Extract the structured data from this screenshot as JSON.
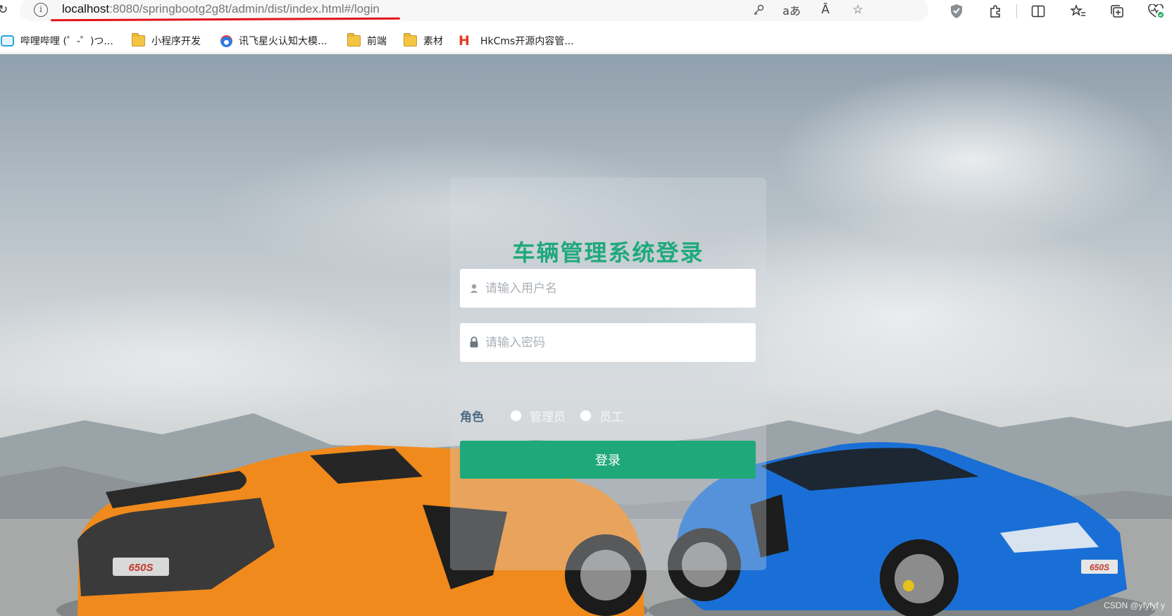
{
  "browser": {
    "url_host": "localhost",
    "url_path": ":8080/springbootg2g8t/admin/dist/index.html#/login",
    "omnibox_icons": [
      "key-icon",
      "translate-icon",
      "read-aloud-icon",
      "favorite-star-icon"
    ],
    "toolbar_icons": [
      "shield-icon",
      "extensions-icon",
      "split-screen-icon",
      "favorites-icon",
      "collections-icon",
      "browser-essentials-icon"
    ],
    "translate_glyph": "aあ",
    "read_aloud_glyph": "Ȃ",
    "bookmarks": [
      {
        "label": "哔哩哔哩 (゜-゜)つ...",
        "icon": "bilibili-tv-icon"
      },
      {
        "label": "小程序开发",
        "icon": "folder-icon"
      },
      {
        "label": "讯飞星火认知大模...",
        "icon": "spark-logo-icon"
      },
      {
        "label": "前端",
        "icon": "folder-icon"
      },
      {
        "label": "素材",
        "icon": "folder-icon"
      },
      {
        "label": "HkCms开源内容管...",
        "icon": "hkcms-logo-icon"
      }
    ]
  },
  "login": {
    "title": "车辆管理系统登录",
    "username_placeholder": "请输入用户名",
    "password_placeholder": "请输入密码",
    "role_label": "角色",
    "roles": [
      "管理员",
      "员工"
    ],
    "submit_label": "登录"
  },
  "background": {
    "description_colors": {
      "sky": "#a9b5be",
      "accent": "#1fa97a",
      "orange_car": "#f08a1c",
      "blue_car": "#1a6fd6"
    },
    "car_badge_left": "650S",
    "car_badge_right": "650S"
  },
  "watermark": "CSDN @yfyfyf y"
}
